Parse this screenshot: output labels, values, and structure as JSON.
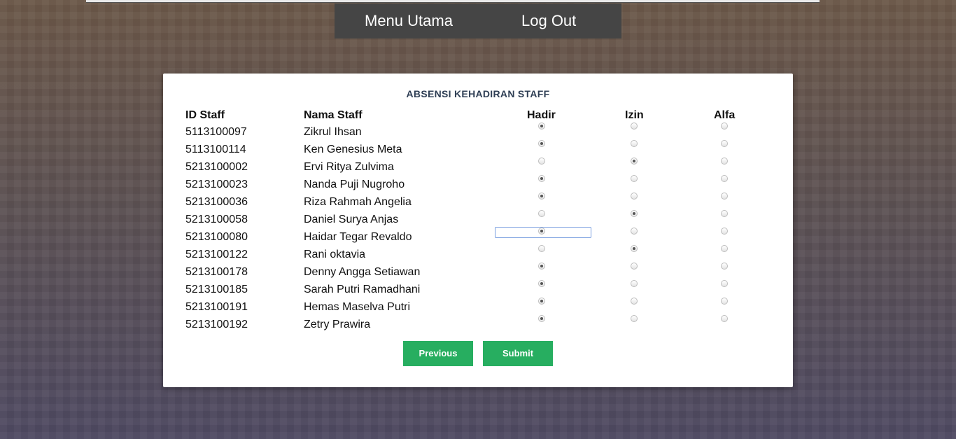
{
  "nav": {
    "menu_label": "Menu Utama",
    "logout_label": "Log Out"
  },
  "form": {
    "title": "ABSENSI KEHADIRAN STAFF",
    "headers": {
      "id": "ID Staff",
      "name": "Nama Staff",
      "hadir": "Hadir",
      "izin": "Izin",
      "alfa": "Alfa"
    },
    "rows": [
      {
        "id": "5113100097",
        "name": "Zikrul Ihsan",
        "status": "Hadir"
      },
      {
        "id": "5113100114",
        "name": "Ken Genesius Meta",
        "status": "Hadir"
      },
      {
        "id": "5213100002",
        "name": "Ervi Ritya Zulvima",
        "status": "Izin"
      },
      {
        "id": "5213100023",
        "name": "Nanda Puji Nugroho",
        "status": "Hadir"
      },
      {
        "id": "5213100036",
        "name": "Riza Rahmah Angelia",
        "status": "Hadir"
      },
      {
        "id": "5213100058",
        "name": "Daniel Surya Anjas",
        "status": "Izin"
      },
      {
        "id": "5213100080",
        "name": "Haidar Tegar Revaldo",
        "status": "Hadir",
        "focused": true
      },
      {
        "id": "5213100122",
        "name": "Rani oktavia",
        "status": "Izin"
      },
      {
        "id": "5213100178",
        "name": "Denny Angga Setiawan",
        "status": "Hadir"
      },
      {
        "id": "5213100185",
        "name": "Sarah Putri Ramadhani",
        "status": "Hadir"
      },
      {
        "id": "5213100191",
        "name": "Hemas Maselva Putri",
        "status": "Hadir"
      },
      {
        "id": "5213100192",
        "name": "Zetry Prawira",
        "status": "Hadir"
      }
    ],
    "previous_label": "Previous",
    "submit_label": "Submit"
  },
  "colors": {
    "button": "#27ae60",
    "nav_bg": "#454545",
    "title": "#2f3f55"
  }
}
